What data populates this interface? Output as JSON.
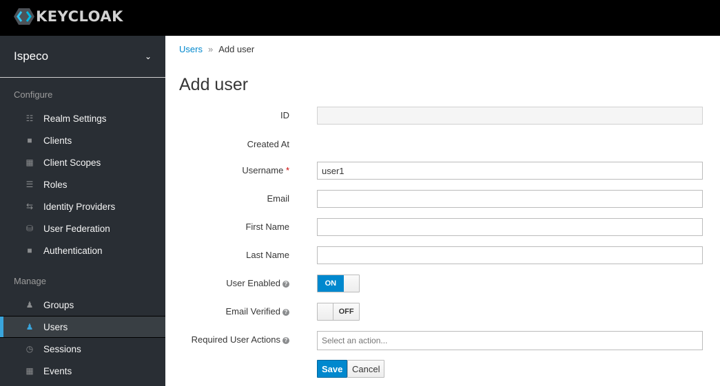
{
  "header": {
    "logo_text": "KEYCLOAK"
  },
  "sidebar": {
    "realm": "Ispeco",
    "configure_label": "Configure",
    "configure_items": [
      {
        "label": "Realm Settings",
        "icon": "sliders-icon"
      },
      {
        "label": "Clients",
        "icon": "cube-icon"
      },
      {
        "label": "Client Scopes",
        "icon": "cubes-icon"
      },
      {
        "label": "Roles",
        "icon": "list-icon"
      },
      {
        "label": "Identity Providers",
        "icon": "exchange-icon"
      },
      {
        "label": "User Federation",
        "icon": "database-icon"
      },
      {
        "label": "Authentication",
        "icon": "lock-icon"
      }
    ],
    "manage_label": "Manage",
    "manage_items": [
      {
        "label": "Groups",
        "icon": "users-icon"
      },
      {
        "label": "Users",
        "icon": "user-icon",
        "active": true
      },
      {
        "label": "Sessions",
        "icon": "clock-icon"
      },
      {
        "label": "Events",
        "icon": "calendar-icon"
      }
    ]
  },
  "breadcrumb": {
    "parent": "Users",
    "separator": "»",
    "current": "Add user"
  },
  "page_title": "Add user",
  "form": {
    "id_label": "ID",
    "id_value": "",
    "created_label": "Created At",
    "username_label": "Username",
    "required_mark": "*",
    "username_value": "user1",
    "email_label": "Email",
    "email_value": "",
    "first_label": "First Name",
    "first_value": "",
    "last_label": "Last Name",
    "last_value": "",
    "enabled_label": "User Enabled",
    "enabled_state": "ON",
    "verified_label": "Email Verified",
    "verified_state": "OFF",
    "actions_label": "Required User Actions",
    "actions_placeholder": "Select an action...",
    "help": "?",
    "save": "Save",
    "cancel": "Cancel"
  },
  "colors": {
    "accent": "#0088ce",
    "sidebar_bg": "#292e34",
    "active_bar": "#39a5dc"
  }
}
